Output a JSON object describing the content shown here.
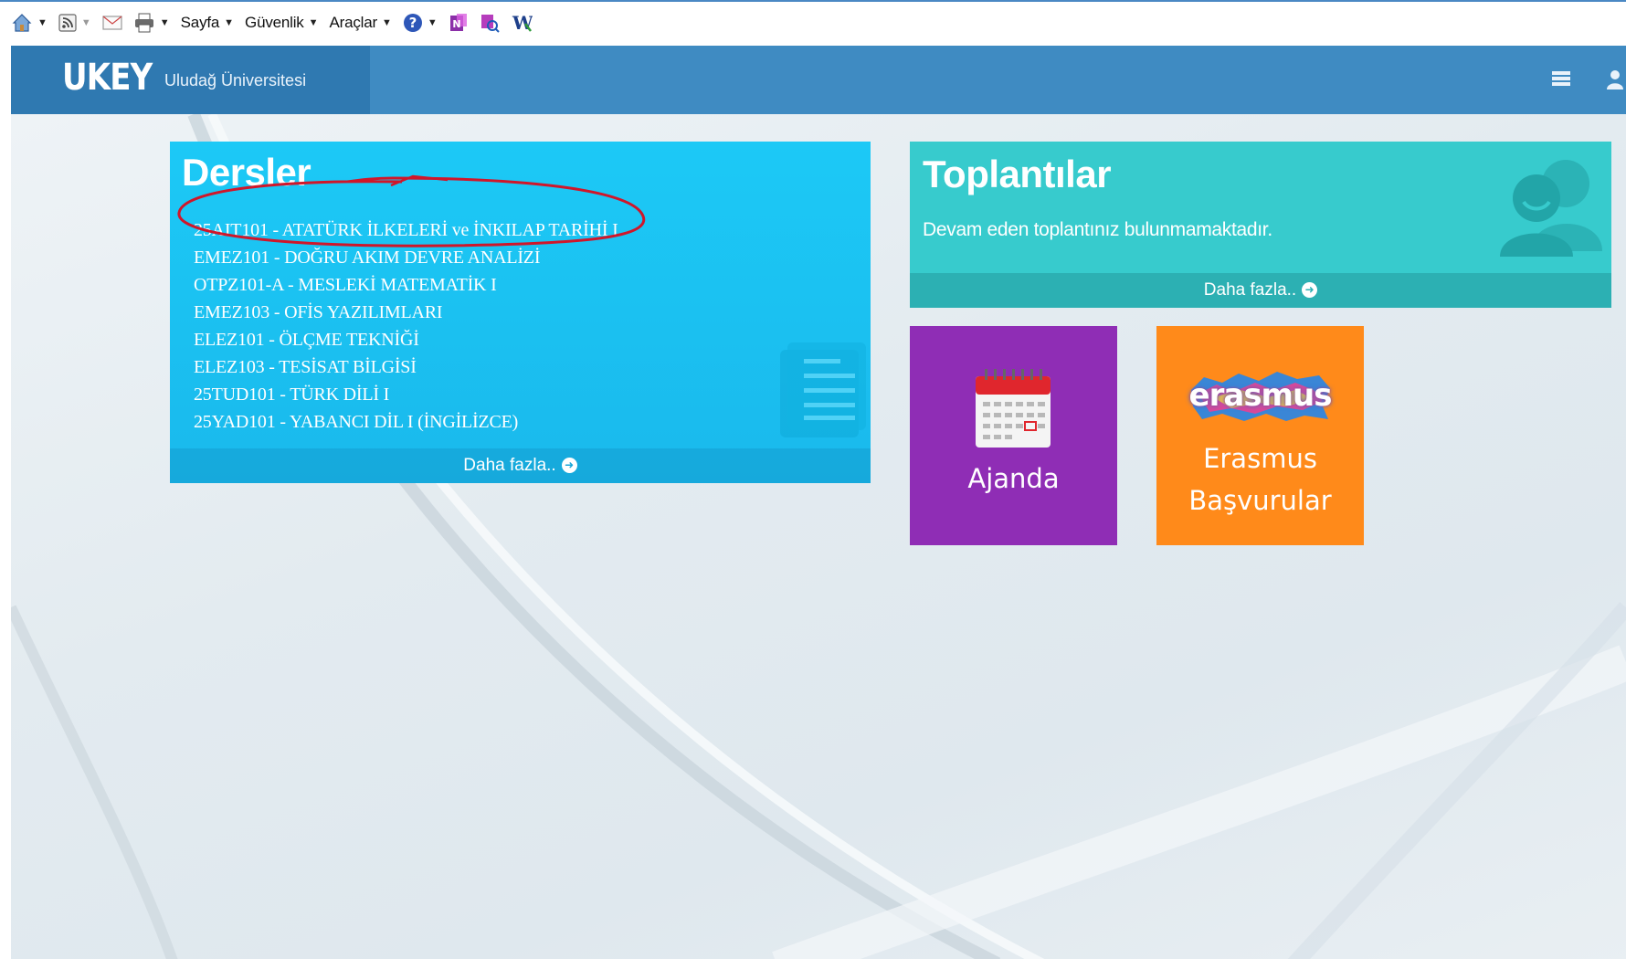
{
  "toolbar": {
    "home_icon": "home-icon",
    "feeds_icon": "rss-icon",
    "mail_icon": "mail-icon",
    "print_icon": "print-icon",
    "menus": [
      "Sayfa",
      "Güvenlik",
      "Araçlar"
    ],
    "help_icon": "help-icon"
  },
  "header": {
    "logo_text": "UKEY",
    "university": "Uludağ Üniversitesi",
    "bg_color": "#3f8bc2",
    "brand_bg_color": "#2f79b1"
  },
  "dersler": {
    "title": "Dersler",
    "courses": [
      "25AIT101 - ATATÜRK İLKELERİ ve İNKILAP TARİHİ I",
      "EMEZ101 - DOĞRU AKIM DEVRE ANALİZİ",
      "OTPZ101-A - MESLEKİ MATEMATİK I",
      "EMEZ103 - OFİS YAZILIMLARI",
      "ELEZ101 - ÖLÇME TEKNİĞİ",
      "ELEZ103 - TESİSAT BİLGİSİ",
      "25TUD101 - TÜRK DİLİ I",
      "25YAD101 - YABANCI DİL I (İNGİLİZCE)"
    ],
    "more": "Daha fazla..",
    "color": "#1cc9f6"
  },
  "toplantilar": {
    "title": "Toplantılar",
    "description": "Devam eden toplantınız bulunmamaktadır.",
    "more": "Daha fazla..",
    "color": "#37cbcd"
  },
  "ajanda": {
    "label": "Ajanda",
    "color": "#8f2db5"
  },
  "erasmus": {
    "logo_text": "erasmus",
    "label_line1": "Erasmus",
    "label_line2": "Başvurular",
    "color": "#ff8a1a"
  },
  "annotation_color": "#d0162a"
}
